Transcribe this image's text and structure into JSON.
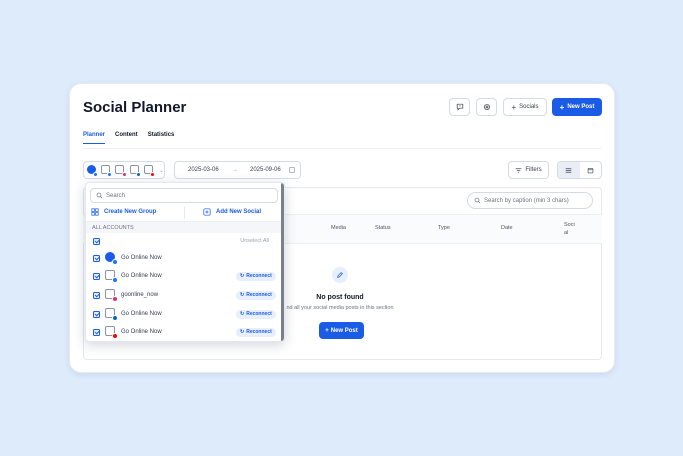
{
  "header": {
    "title": "Social Planner",
    "socials_label": "Socials",
    "new_post_label": "New Post"
  },
  "tabs": [
    {
      "label": "Planner",
      "active": true
    },
    {
      "label": "Content",
      "active": false
    },
    {
      "label": "Statistics",
      "active": false
    }
  ],
  "date_range": {
    "start": "2025-03-06",
    "arrow": "→",
    "end": "2025-09-06"
  },
  "toolbar": {
    "filters_label": "Filters"
  },
  "search_caption": {
    "placeholder": "Search by caption (min 3 chars)"
  },
  "table": {
    "columns": [
      "Media",
      "Status",
      "Type",
      "Date",
      "Soci al"
    ]
  },
  "empty_state": {
    "title": "No post found",
    "subtitle": "nd all your social media posts in this section",
    "button_label": "New Post"
  },
  "dropdown": {
    "search_placeholder": "Search",
    "create_group_label": "Create New Group",
    "add_social_label": "Add New Social",
    "section_label": "ALL ACCOUNTS",
    "unselect_label": "Unselect All",
    "reconnect_label": "Reconnect",
    "accounts": [
      {
        "name": "Go Online Now",
        "network": "facebook",
        "reconnect": false
      },
      {
        "name": "Go Online Now",
        "network": "facebook",
        "reconnect": true
      },
      {
        "name": "goonline_now",
        "network": "instagram",
        "reconnect": true
      },
      {
        "name": "Go Online Now",
        "network": "linkedin",
        "reconnect": true
      },
      {
        "name": "Go Online Now",
        "network": "youtube",
        "reconnect": true
      }
    ]
  },
  "colors": {
    "accent": "#1b5ce6",
    "background": "#ddebfb",
    "facebook": "#1877f2",
    "instagram": "#e1306c",
    "linkedin": "#0a66c2",
    "youtube": "#ff0000"
  }
}
